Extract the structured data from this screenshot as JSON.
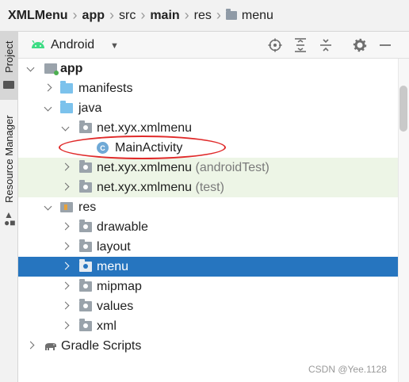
{
  "breadcrumb": {
    "items": [
      "XMLMenu",
      "app",
      "src",
      "main",
      "res",
      "menu"
    ]
  },
  "side_strip": {
    "project_label": "Project",
    "resource_manager_label": "Resource Manager"
  },
  "toolbar": {
    "view_mode": "Android"
  },
  "tree": {
    "app": "app",
    "manifests": "manifests",
    "java": "java",
    "pkg_main": "net.xyx.xmlmenu",
    "main_activity": "MainActivity",
    "class_badge": "C",
    "pkg_android_test": "net.xyx.xmlmenu",
    "pkg_android_test_suffix": "(androidTest)",
    "pkg_test": "net.xyx.xmlmenu",
    "pkg_test_suffix": "(test)",
    "res": "res",
    "drawable": "drawable",
    "layout": "layout",
    "menu": "menu",
    "mipmap": "mipmap",
    "values": "values",
    "xml": "xml",
    "gradle_scripts": "Gradle Scripts"
  },
  "colors": {
    "selection": "#2675bf",
    "test_rows": "#edf5e6",
    "annotation": "#e02a2a",
    "android_green": "#3ddc84"
  },
  "watermark": "CSDN @Yee.1128"
}
